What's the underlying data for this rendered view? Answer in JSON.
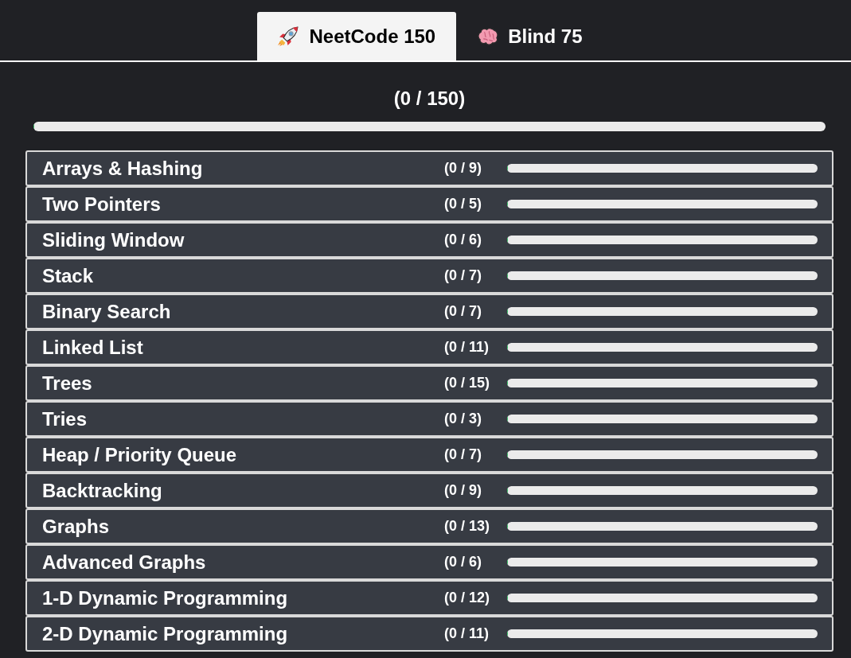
{
  "tabs": [
    {
      "label": "NeetCode 150",
      "selected": true
    },
    {
      "label": "Blind 75",
      "selected": false
    }
  ],
  "total": {
    "count": "(0 / 150)",
    "level": 0
  },
  "topics": [
    {
      "title": "Arrays & Hashing",
      "count": "(0 / 9)",
      "level": 0
    },
    {
      "title": "Two Pointers",
      "count": "(0 / 5)",
      "level": 0
    },
    {
      "title": "Sliding Window",
      "count": "(0 / 6)",
      "level": 0
    },
    {
      "title": "Stack",
      "count": "(0 / 7)",
      "level": 0
    },
    {
      "title": "Binary Search",
      "count": "(0 / 7)",
      "level": 0
    },
    {
      "title": "Linked List",
      "count": "(0 / 11)",
      "level": 0
    },
    {
      "title": "Trees",
      "count": "(0 / 15)",
      "level": 0
    },
    {
      "title": "Tries",
      "count": "(0 / 3)",
      "level": 0
    },
    {
      "title": "Heap / Priority Queue",
      "count": "(0 / 7)",
      "level": 0
    },
    {
      "title": "Backtracking",
      "count": "(0 / 9)",
      "level": 0
    },
    {
      "title": "Graphs",
      "count": "(0 / 13)",
      "level": 0
    },
    {
      "title": "Advanced Graphs",
      "count": "(0 / 6)",
      "level": 0
    },
    {
      "title": "1-D Dynamic Programming",
      "count": "(0 / 12)",
      "level": 0
    },
    {
      "title": "2-D Dynamic Programming",
      "count": "(0 / 11)",
      "level": 0
    }
  ]
}
